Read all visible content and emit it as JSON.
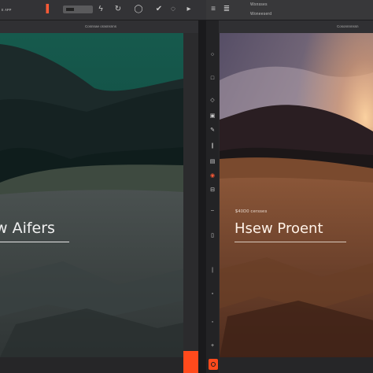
{
  "toolbar_left": {
    "app_label": "ᴇ ᴀᴘᴘ",
    "icons": [
      "flash-icon",
      "cycle-icon",
      "info-icon",
      "leaf-icon",
      "eye-icon"
    ]
  },
  "toolbar_right": {
    "label_top": "Wsnsses",
    "label_bottom": "Woneeserd"
  },
  "panels": {
    "left": {
      "header": "Cosnnae orasnsnns",
      "title": "w Aifers"
    },
    "right": {
      "header": "Cosonnnnssn",
      "caption": "$40D0 cersses",
      "title": "Hsew Proent"
    }
  },
  "tools": [
    "circle-icon",
    "square-icon",
    "diamond-icon",
    "copy-icon",
    "pen-icon",
    "brush-icon",
    "target-icon",
    "sliders-icon",
    "dash-icon",
    "hand-icon"
  ],
  "colors": {
    "accent": "#ff4a1c",
    "left_sky": "#0f4f44",
    "right_sky": "#6d6278",
    "right_sun": "#f0a46a"
  }
}
